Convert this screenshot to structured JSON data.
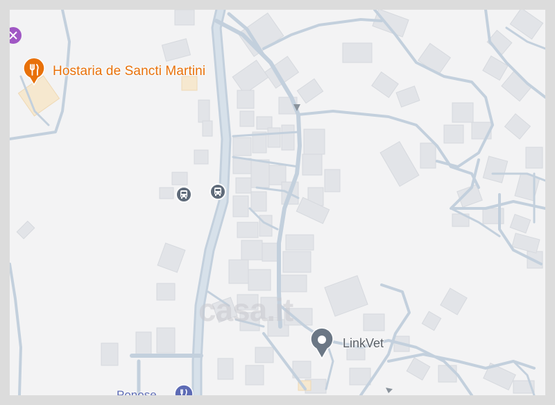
{
  "map": {
    "pois": [
      {
        "id": "restaurant",
        "label": "Hostaria de Sancti Martini",
        "icon": "fork-knife-icon",
        "color": "#e8710a"
      },
      {
        "id": "vet",
        "label": "LinkVet",
        "icon": "location-pin-icon",
        "color": "#6b7785"
      },
      {
        "id": "bottom",
        "label": "Ponose",
        "icon": "restaurant-icon",
        "color": "#5d6bb5"
      }
    ],
    "bus_stops": [
      {
        "icon": "bus-icon"
      },
      {
        "icon": "bus-icon"
      }
    ],
    "watermark": "casa.it",
    "colors": {
      "background": "#f3f3f4",
      "road": "#c7d3df",
      "building": "#e1e3e7",
      "frame": "#dcdcdc"
    }
  }
}
